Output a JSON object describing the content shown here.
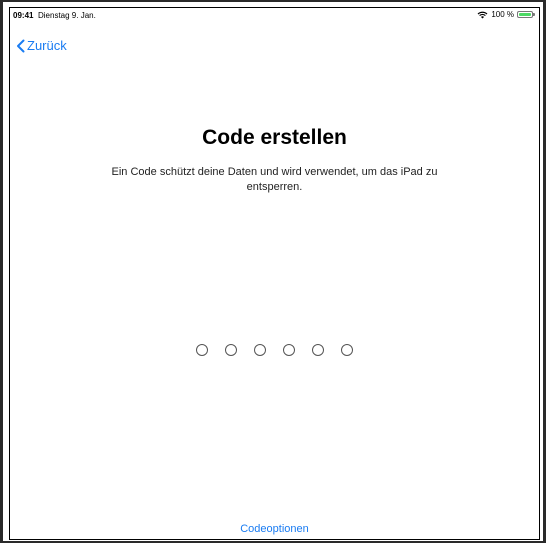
{
  "status_bar": {
    "time": "09:41",
    "date": "Dienstag 9. Jan.",
    "battery_percent": "100 %",
    "wifi_icon": "wifi-icon",
    "battery_icon": "battery-icon"
  },
  "nav": {
    "back_label": "Zurück",
    "back_icon": "chevron-left-icon"
  },
  "main": {
    "title": "Code erstellen",
    "subtitle_line1": "Ein Code schützt deine Daten und wird verwendet, um das iPad zu",
    "subtitle_line2": "entsperren.",
    "passcode_length": 6,
    "passcode_entered": 0,
    "options_label": "Codeoptionen"
  },
  "colors": {
    "accent": "#1a7cf2",
    "battery": "#4cd964"
  }
}
